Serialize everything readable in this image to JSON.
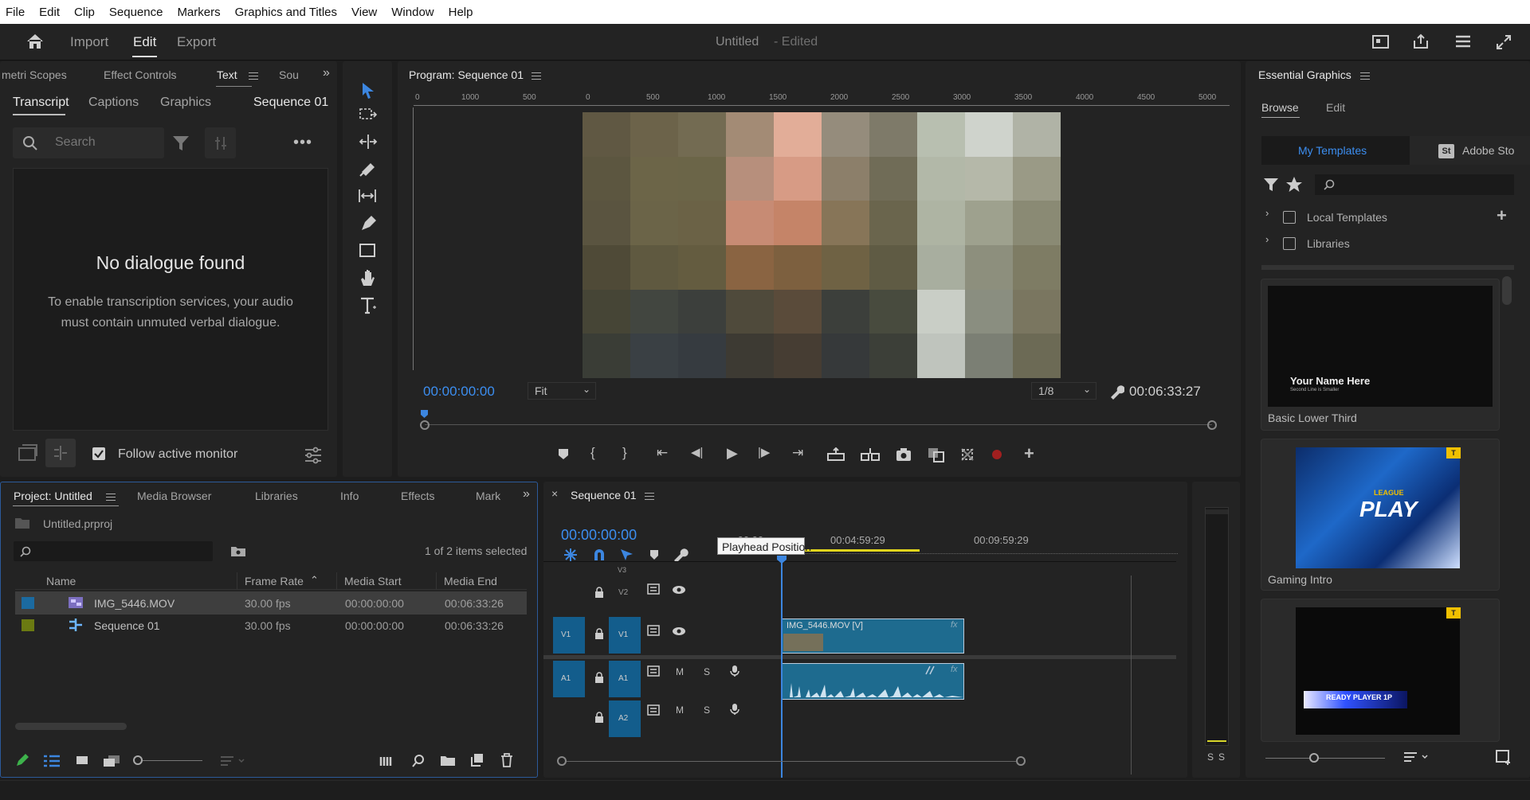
{
  "menu": [
    "File",
    "Edit",
    "Clip",
    "Sequence",
    "Markers",
    "Graphics and Titles",
    "View",
    "Window",
    "Help"
  ],
  "workspace": {
    "tabs": [
      "Import",
      "Edit",
      "Export"
    ],
    "active": "Edit",
    "title": "Untitled",
    "edited": "- Edited"
  },
  "left_panel": {
    "tabs": [
      "metri Scopes",
      "Effect Controls",
      "Text",
      "Sou"
    ],
    "subtabs": [
      "Transcript",
      "Captions",
      "Graphics"
    ],
    "sequence": "Sequence 01",
    "search_placeholder": "Search",
    "empty_title": "No dialogue found",
    "empty_body": "To enable transcription services, your audio must contain unmuted verbal dialogue.",
    "follow_label": "Follow active monitor"
  },
  "program": {
    "title": "Program: Sequence 01",
    "ruler": [
      "0",
      "1000",
      "500",
      "0",
      "500",
      "1000",
      "1500",
      "2000",
      "2500",
      "3000",
      "3500",
      "4000",
      "4500",
      "5000"
    ],
    "timecode": "00:00:00:00",
    "fit": "Fit",
    "res": "1/8",
    "duration": "00:06:33:27"
  },
  "project": {
    "tabs": [
      "Project: Untitled",
      "Media Browser",
      "Libraries",
      "Info",
      "Effects",
      "Mark"
    ],
    "file": "Untitled.prproj",
    "selected": "1 of 2 items selected",
    "columns": [
      "Name",
      "Frame Rate",
      "Media Start",
      "Media End"
    ],
    "rows": [
      {
        "name": "IMG_5446.MOV",
        "rate": "30.00 fps",
        "start": "00:00:00:00",
        "end": "00:06:33:26",
        "color": "#1b6aa0"
      },
      {
        "name": "Sequence 01",
        "rate": "30.00 fps",
        "start": "00:00:00:00",
        "end": "00:06:33:26",
        "color": "#6b7a12"
      }
    ]
  },
  "timeline": {
    "tab": "Sequence 01",
    "timecode": "00:00:00:00",
    "ticks": [
      ":00:00",
      "00:04:59:29",
      "00:09:59:29"
    ],
    "tooltip": "Playhead Position",
    "tracks": {
      "v3": "V3",
      "v2": "V2",
      "v1": "V1",
      "a1": "A1",
      "a2": "A2"
    },
    "video_clip": "IMG_5446.MOV [V]",
    "fx": "fx"
  },
  "meter": {
    "labels": [
      "S",
      "S"
    ]
  },
  "essential_graphics": {
    "title": "Essential Graphics",
    "tabs": [
      "Browse",
      "Edit"
    ],
    "my_templates": "My Templates",
    "adobe_stock": "Adobe Sto",
    "st_badge": "St",
    "folders": [
      "Local Templates",
      "Libraries"
    ],
    "templates": [
      {
        "name": "Basic Lower Third",
        "line1": "Your Name Here",
        "line2": "Second Line is Smaller"
      },
      {
        "name": "Gaming Intro",
        "line1": "LEAGUE",
        "line2": "PLAY"
      },
      {
        "name": "",
        "line1": "READY PLAYER 1P"
      }
    ]
  },
  "colors": {
    "accent": "#2d8ceb",
    "clip": "#1e6b8f",
    "track_blue": "#135d8c",
    "playhead": "#3c86e0"
  }
}
